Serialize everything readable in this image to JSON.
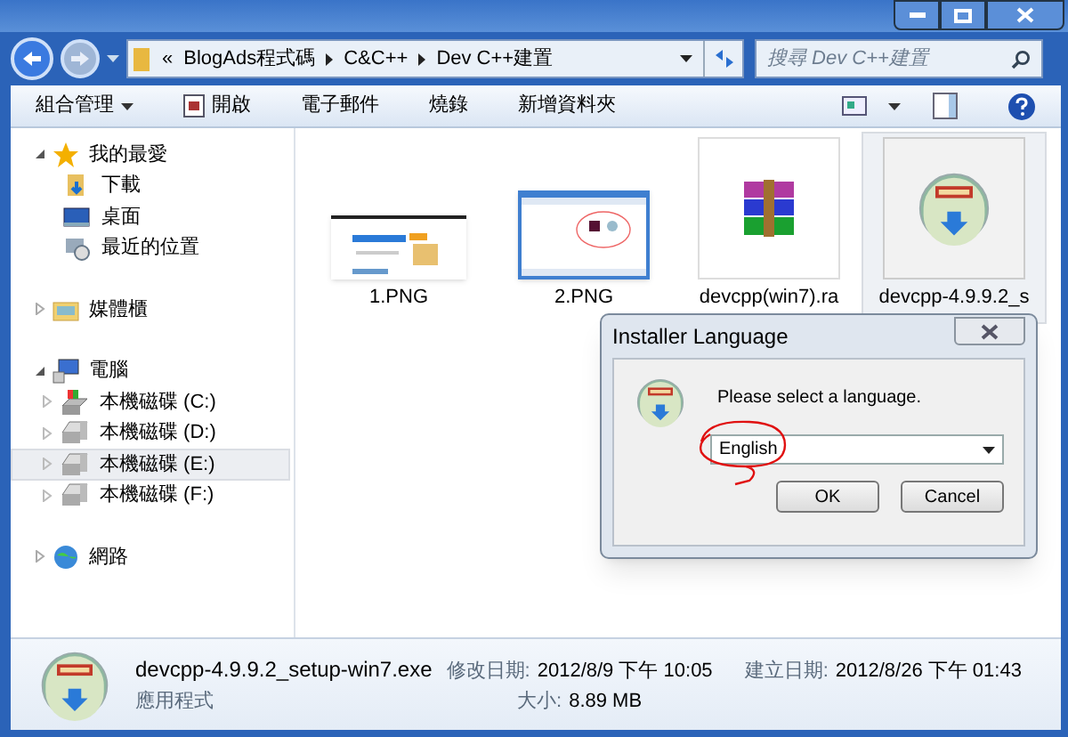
{
  "address": {
    "overflow": "«",
    "crumbs": [
      "BlogAds程式碼",
      "C&C++",
      "Dev C++建置"
    ]
  },
  "search": {
    "placeholder": "搜尋 Dev C++建置"
  },
  "toolbar": [
    {
      "label": "組合管理",
      "dropdown": true
    },
    {
      "label": "開啟",
      "dropdown": false
    },
    {
      "label": "電子郵件",
      "dropdown": false
    },
    {
      "label": "燒錄",
      "dropdown": false
    },
    {
      "label": "新增資料夾",
      "dropdown": false
    }
  ],
  "nav": [
    {
      "label": "我的最愛",
      "kind": "star",
      "expanded": true,
      "children": [
        {
          "label": "下載",
          "kind": "download",
          "selected": false
        },
        {
          "label": "桌面",
          "kind": "desktop",
          "selected": false
        },
        {
          "label": "最近的位置",
          "kind": "recent",
          "selected": false
        }
      ]
    },
    {
      "label": "媒體櫃",
      "kind": "library",
      "expanded": false
    },
    {
      "label": "電腦",
      "kind": "computer",
      "expanded": true,
      "children": [
        {
          "label": "本機磁碟 (C:)",
          "kind": "sysdrive",
          "selected": false
        },
        {
          "label": "本機磁碟 (D:)",
          "kind": "drive",
          "selected": false
        },
        {
          "label": "本機磁碟 (E:)",
          "kind": "drive",
          "selected": true
        },
        {
          "label": "本機磁碟 (F:)",
          "kind": "drive",
          "selected": false
        }
      ]
    },
    {
      "label": "網路",
      "kind": "network",
      "expanded": false
    }
  ],
  "files": [
    {
      "name": "1.PNG",
      "kind": "webpage",
      "selected": false
    },
    {
      "name": "2.PNG",
      "kind": "screenshot",
      "selected": false
    },
    {
      "name": "devcpp(win7).ra",
      "kind": "archive",
      "selected": false
    },
    {
      "name": "devcpp-4.9.9.2_s",
      "kind": "installer",
      "selected": true
    }
  ],
  "dialog": {
    "title": "Installer Language",
    "message": "Please select a language.",
    "language": "English",
    "buttons": [
      "OK",
      "Cancel"
    ]
  },
  "details": {
    "name": "devcpp-4.9.9.2_setup-win7.exe",
    "type": "應用程式",
    "fields": [
      {
        "label": "修改日期:",
        "value": "2012/8/9 下午 10:05"
      },
      {
        "label": "建立日期:",
        "value": "2012/8/26 下午 01:43"
      },
      {
        "label": "大小:",
        "value": "8.89 MB"
      }
    ]
  }
}
